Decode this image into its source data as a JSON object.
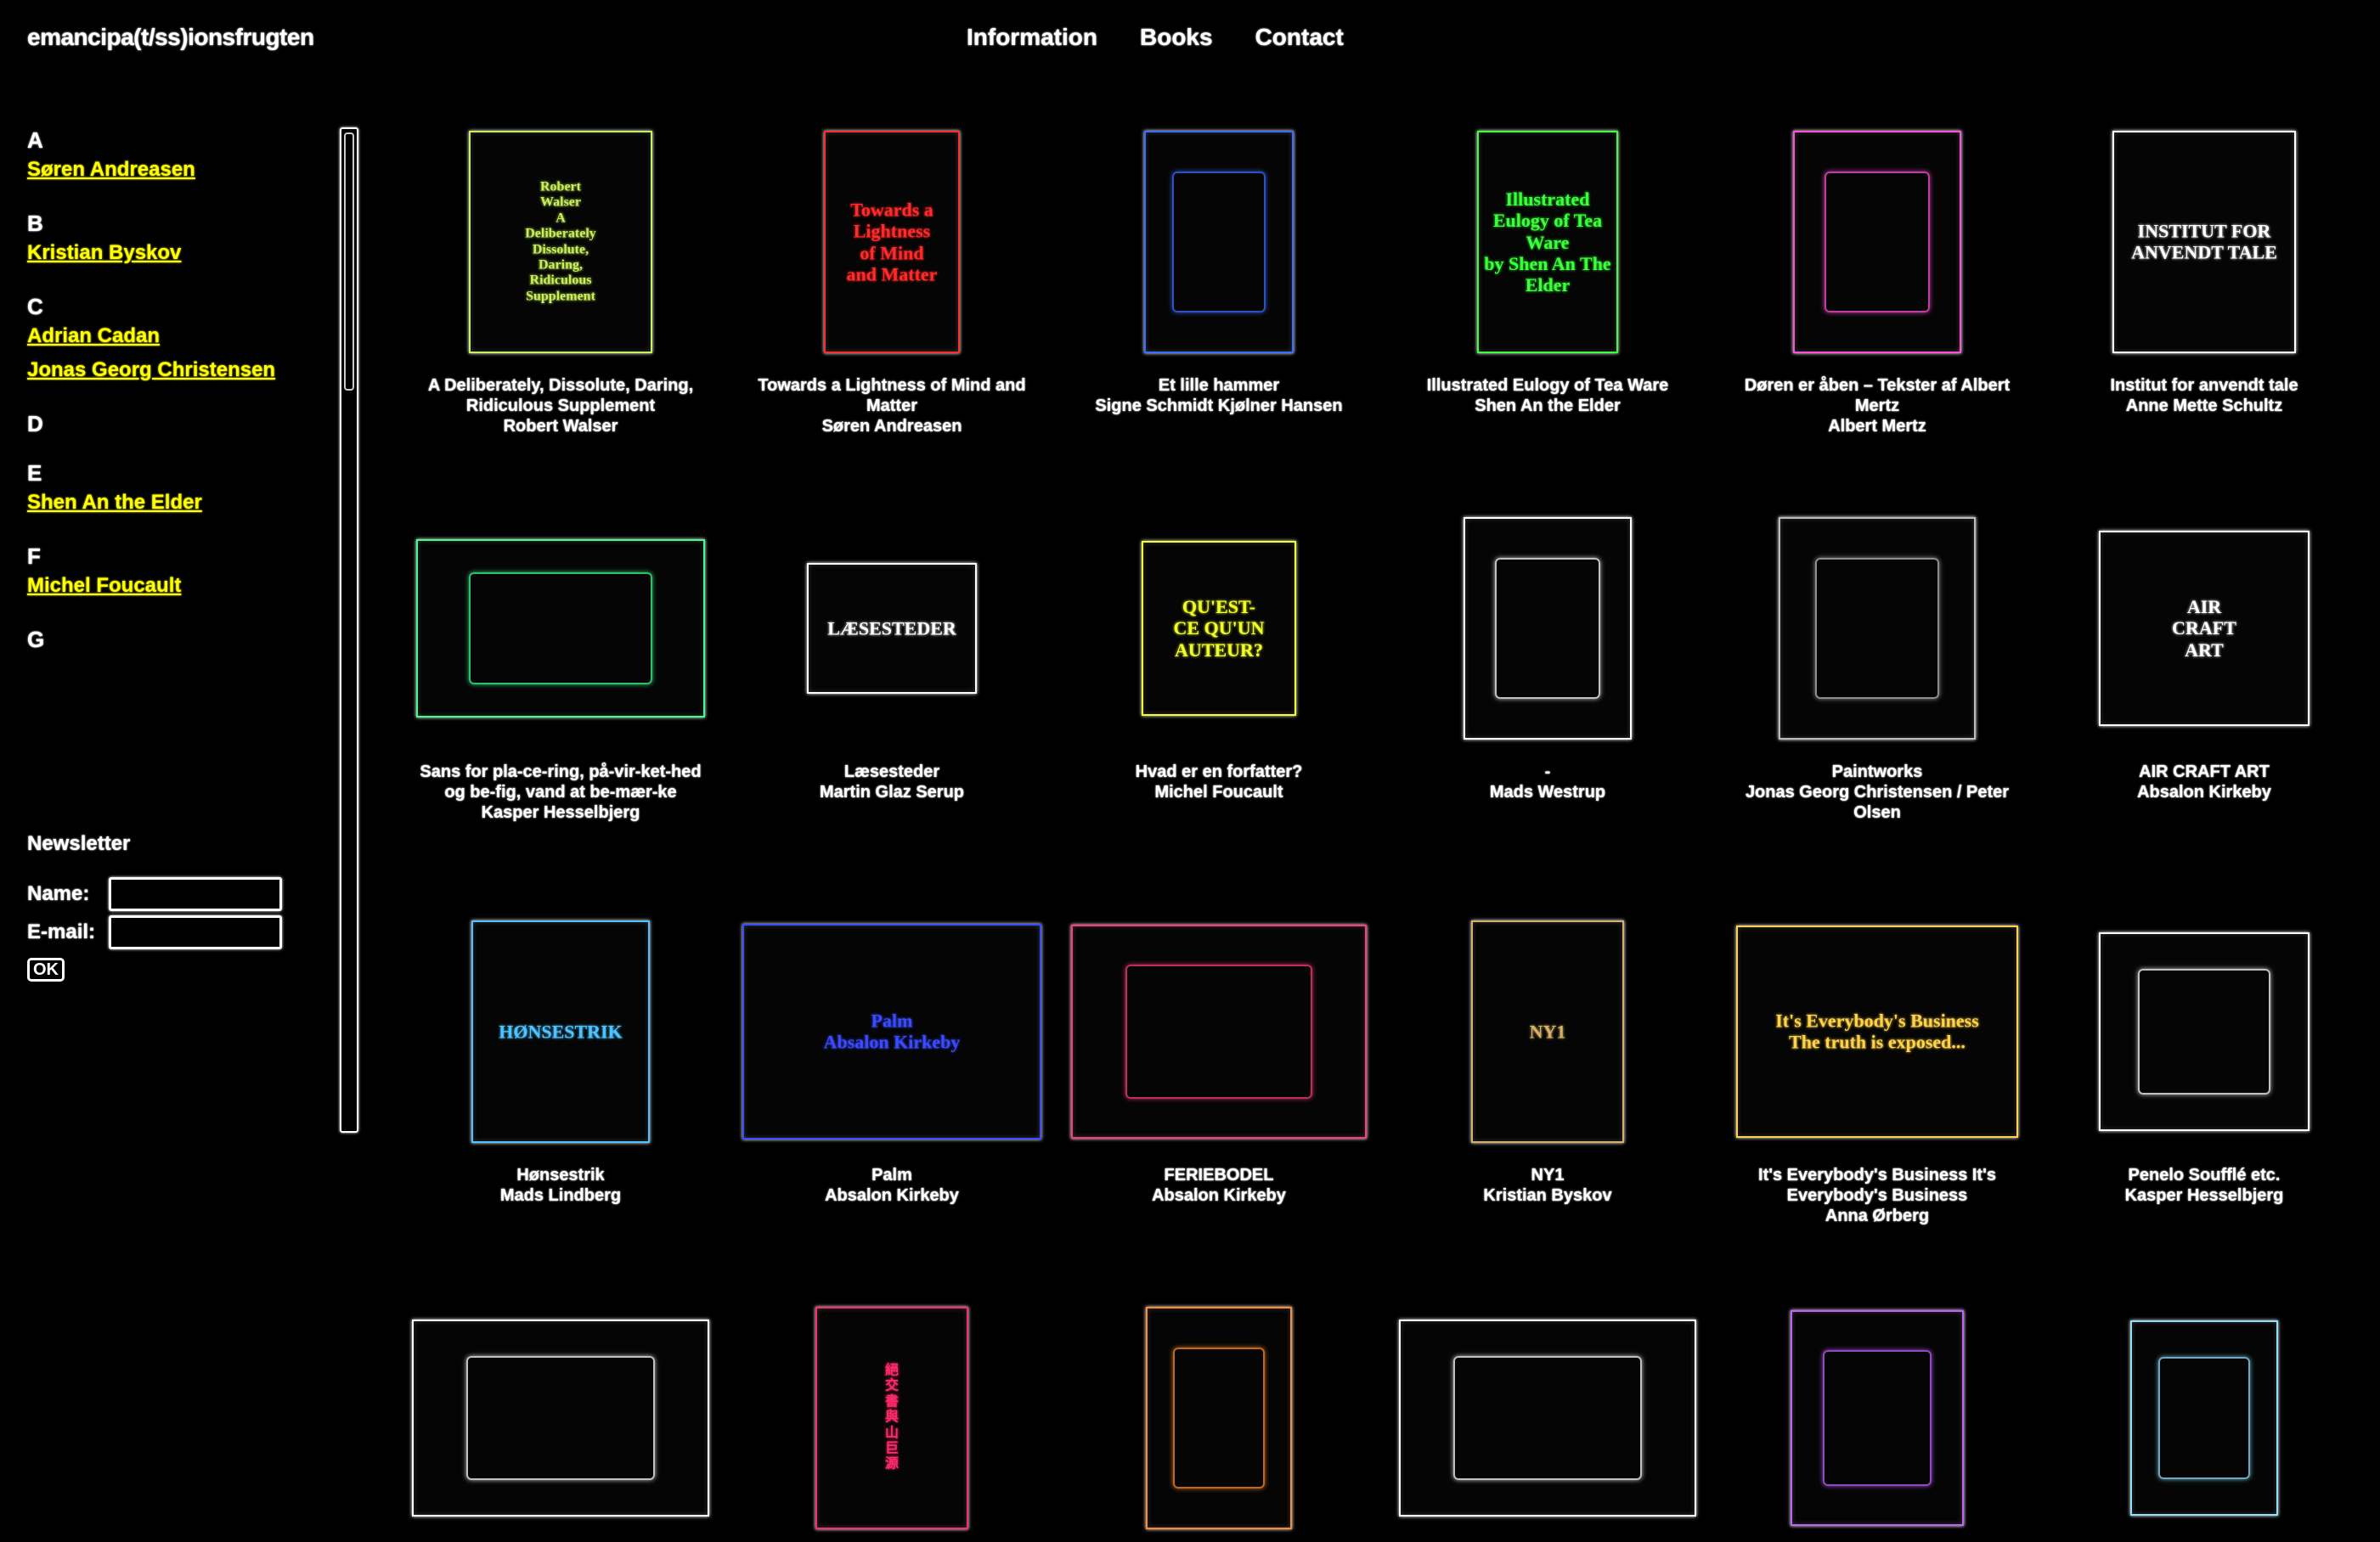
{
  "header": {
    "site_title": "emancipa(t/ss)ionsfrugten",
    "nav": [
      "Information",
      "Books",
      "Contact"
    ]
  },
  "index": [
    {
      "letter": "A",
      "names": [
        "Søren Andreasen"
      ]
    },
    {
      "letter": "B",
      "names": [
        "Kristian Byskov"
      ]
    },
    {
      "letter": "C",
      "names": [
        "Adrian Cadan",
        "Jonas Georg Christensen"
      ]
    },
    {
      "letter": "D",
      "names": []
    },
    {
      "letter": "E",
      "names": [
        "Shen An the Elder"
      ]
    },
    {
      "letter": "F",
      "names": [
        "Michel Foucault"
      ]
    },
    {
      "letter": "G",
      "names": []
    }
  ],
  "newsletter": {
    "title": "Newsletter",
    "name_label": "Name:",
    "email_label": "E-mail:",
    "ok_label": "OK"
  },
  "books": [
    {
      "title": "A Deliberately, Dissolute, Daring, Ridiculous Supplement",
      "author": "Robert Walser",
      "cover_text": [
        "Robert",
        "Walser",
        "A",
        "Deliberately",
        "Dissolute,",
        "Daring,",
        "Ridiculous",
        "Supplement"
      ],
      "accent": "#c8f05a"
    },
    {
      "title": "Towards a Lightness of Mind and Matter",
      "author": "Søren Andreasen",
      "cover_text": [
        "Towards a",
        "Lightness",
        "of Mind",
        "and Matter"
      ],
      "accent": "#ff2a2a"
    },
    {
      "title": "Et lille hammer",
      "author": "Signe Schmidt Kjølner Hansen",
      "cover_text": [],
      "accent": "#3a6bff"
    },
    {
      "title": "Illustrated Eulogy of Tea Ware",
      "author": "Shen An the Elder",
      "cover_text": [
        "Illustrated Eulogy of Tea Ware",
        "by Shen An The Elder"
      ],
      "accent": "#3cff3c"
    },
    {
      "title": "Døren er åben – Tekster af Albert Mertz",
      "author": "Albert Mertz",
      "cover_text": [],
      "accent": "#ff4fd8"
    },
    {
      "title": "Institut for anvendt tale",
      "author": "Anne Mette Schultz",
      "cover_text": [
        "INSTITUT FOR",
        "ANVENDT TALE"
      ],
      "accent": "#ffffff"
    },
    {
      "title": "Sans for pla-ce-ring, på-vir-ket-hed og be-fig, vand at be-mær-ke",
      "author": "Kasper Hesselbjerg",
      "cover_text": [],
      "accent": "#3cff8c"
    },
    {
      "title": "Læsesteder",
      "author": "Martin Glaz Serup",
      "cover_text": [
        "LÆSESTEDER"
      ],
      "accent": "#ffffff"
    },
    {
      "title": "Hvad er en forfatter?",
      "author": "Michel Foucault",
      "cover_text": [
        "QU'EST-",
        "CE QU'UN",
        "AUTEUR?"
      ],
      "accent": "#f0ff28"
    },
    {
      "title": "-",
      "author": "Mads Westrup",
      "cover_text": [],
      "accent": "#ffffff"
    },
    {
      "title": "Paintworks",
      "author": "Jonas Georg Christensen / Peter Olsen",
      "cover_text": [],
      "accent": "#bbbbbb"
    },
    {
      "title": "AIR CRAFT ART",
      "author": "Absalon Kirkeby",
      "cover_text": [
        "AIR",
        "CRAFT",
        "ART"
      ],
      "accent": "#ffffff"
    },
    {
      "title": "Hønsestrik",
      "author": "Mads Lindberg",
      "cover_text": [
        "HØNSESTRIK"
      ],
      "accent": "#4fc3ff"
    },
    {
      "title": "Palm",
      "author": "Absalon Kirkeby",
      "cover_text": [
        "Palm",
        "Absalon Kirkeby"
      ],
      "accent": "#3a4bff"
    },
    {
      "title": "FERIEBODEL",
      "author": "Absalon Kirkeby",
      "cover_text": [],
      "accent": "#ff3a7a"
    },
    {
      "title": "NY1",
      "author": "Kristian Byskov",
      "cover_text": [
        "NY1"
      ],
      "accent": "#d4b06a"
    },
    {
      "title": "It's Everybody's Business It's Everybody's Business",
      "author": "Anna Ørberg",
      "cover_text": [
        "It's Everybody's Business",
        "The truth is exposed..."
      ],
      "accent": "#ffd24a"
    },
    {
      "title": "Penelo Soufflé etc.",
      "author": "Kasper Hesselbjerg",
      "cover_text": [],
      "accent": "#ffffff"
    },
    {
      "title": "",
      "author": "",
      "cover_text": [],
      "accent": "#ffffff"
    },
    {
      "title": "",
      "author": "",
      "cover_text": [
        "絕",
        "交",
        "書",
        "與",
        "山",
        "巨",
        "源"
      ],
      "accent": "#ff2a6a"
    },
    {
      "title": "",
      "author": "",
      "cover_text": [],
      "accent": "#ff8a2a"
    },
    {
      "title": "",
      "author": "",
      "cover_text": [],
      "accent": "#ffffff"
    },
    {
      "title": "",
      "author": "",
      "cover_text": [],
      "accent": "#c060ff"
    },
    {
      "title": "",
      "author": "",
      "cover_text": [],
      "accent": "#8fe0ff"
    }
  ]
}
